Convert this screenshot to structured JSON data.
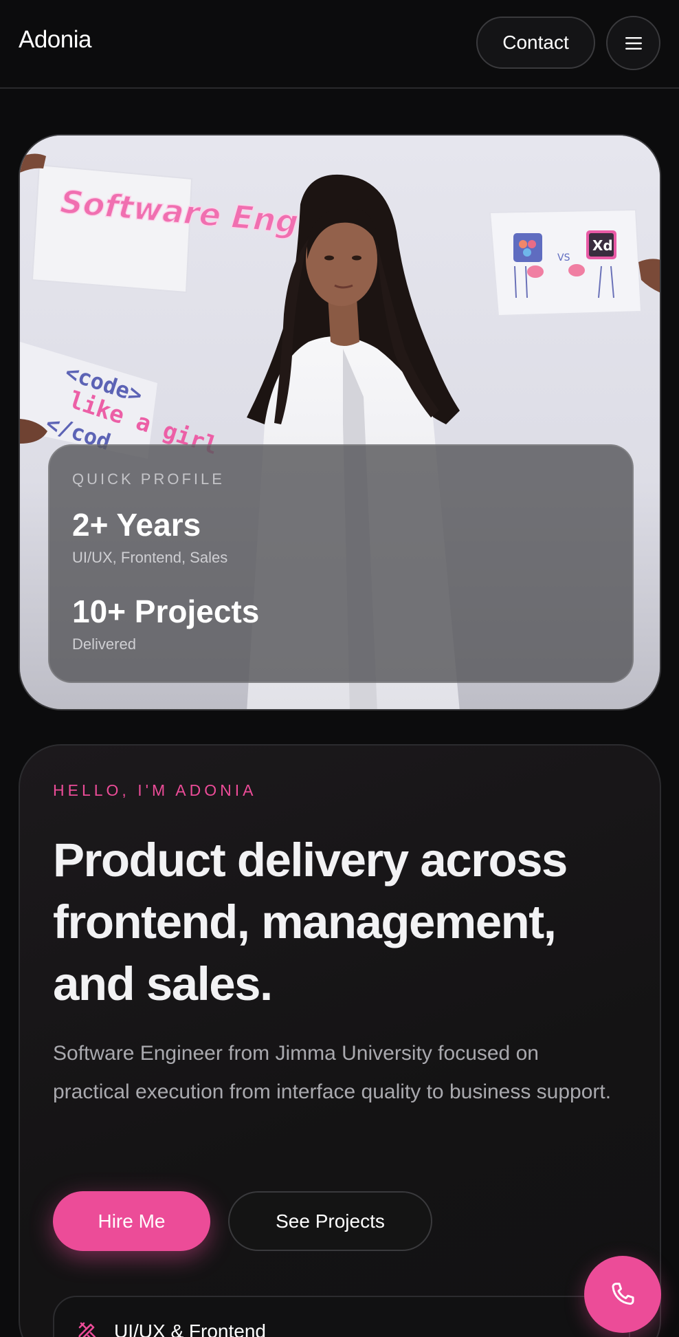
{
  "header": {
    "brand": "Adonia",
    "contact_label": "Contact",
    "menu_icon": "hamburger-icon"
  },
  "hero": {
    "image_signs": {
      "left_top": "Software Engineer",
      "left_bottom_line1": "<code>",
      "left_bottom_line2": "like a girl",
      "left_bottom_line3": "</cod",
      "right_vs": "VS",
      "right_xd": "Xd"
    },
    "profile": {
      "label": "QUICK PROFILE",
      "stats": [
        {
          "value": "2+ Years",
          "sub": "UI/UX, Frontend, Sales"
        },
        {
          "value": "10+ Projects",
          "sub": "Delivered"
        }
      ]
    }
  },
  "intro": {
    "eyebrow": "HELLO, I'M ADONIA",
    "headline": "Product delivery across frontend, management, and sales.",
    "lead": "Software Engineer from Jimma University focused on practical execution from interface quality to business support.",
    "primary_cta": "Hire Me",
    "secondary_cta": "See Projects",
    "skills": [
      {
        "label": "UI/UX & Frontend",
        "icon": "design-tools-icon"
      }
    ]
  },
  "fab": {
    "icon": "phone-icon"
  },
  "colors": {
    "accent": "#ec4c98",
    "background": "#0c0c0d",
    "card_border": "#2c2c2f",
    "muted_text": "#a9a9ae"
  }
}
